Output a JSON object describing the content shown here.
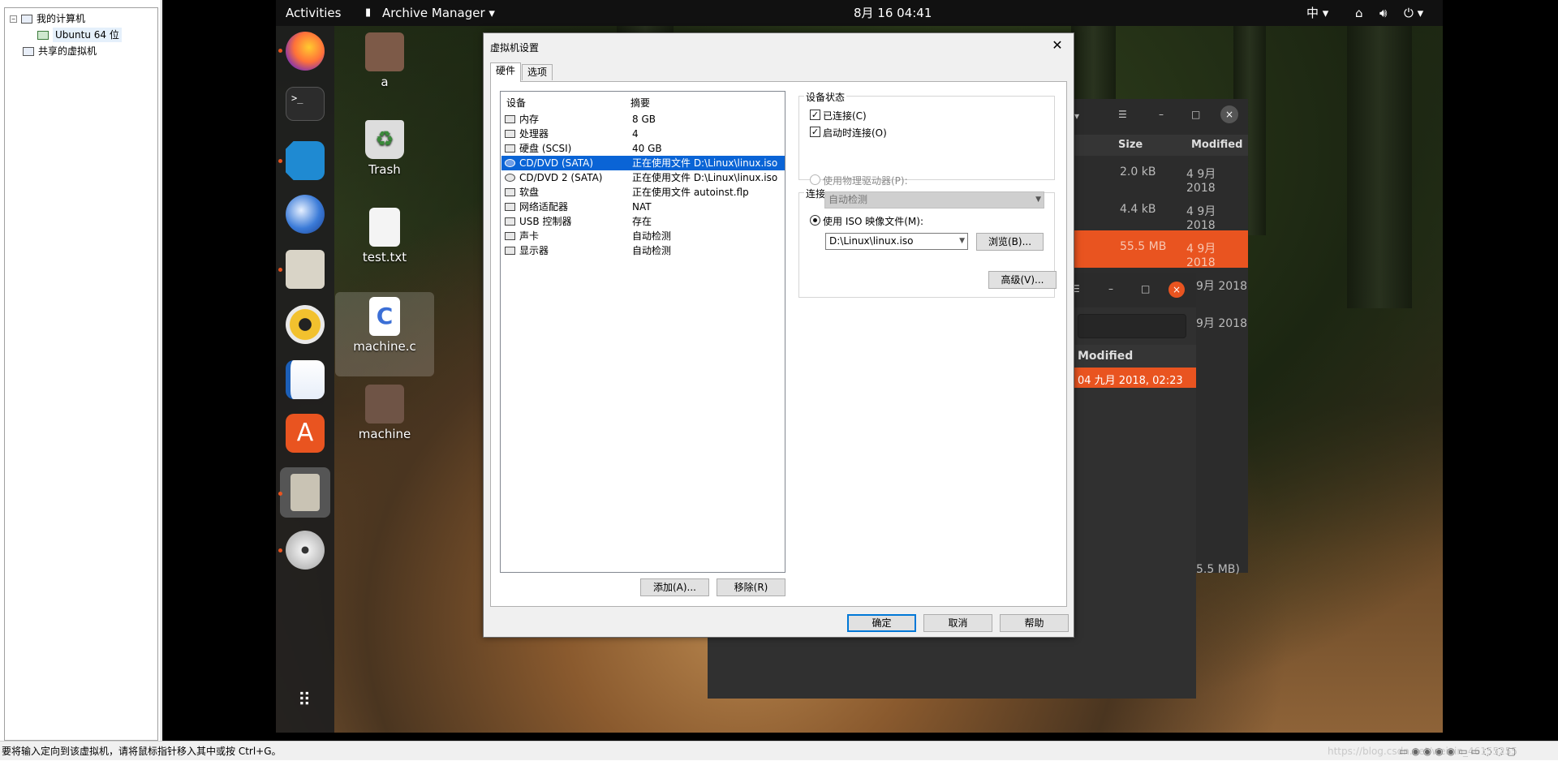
{
  "library": {
    "tree": [
      {
        "label": "我的计算机",
        "expander": "−"
      },
      {
        "label": "Ubuntu 64 位"
      },
      {
        "label": "共享的虚拟机",
        "expander": ""
      }
    ]
  },
  "ubuntu": {
    "activities": "Activities",
    "app_menu": "Archive Manager",
    "clock": "8月 16  04:41",
    "input_method": "中",
    "desktop_icons": [
      "a",
      "Trash",
      "test.txt",
      "machine.c",
      "machine"
    ],
    "dock_apps": [
      "firefox-icon",
      "terminal-icon",
      "vscode-icon",
      "thunderbird-icon",
      "files-icon",
      "rhythmbox-icon",
      "writer-icon",
      "software-icon",
      "archive-icon",
      "dvd-icon",
      "app-grid-icon"
    ]
  },
  "archive_window_back": {
    "columns": [
      "Size",
      "Modified"
    ],
    "rows": [
      {
        "size": "2.0 kB",
        "modified": "4 9月 2018"
      },
      {
        "size": "4.4 kB",
        "modified": "4 9月 2018"
      },
      {
        "size": "55.5 MB",
        "modified": "4 9月 2018"
      },
      {
        "size": "",
        "modified": "9月 2018"
      },
      {
        "size": "",
        "modified": "9月 2018"
      }
    ],
    "footer": "5.5 MB)"
  },
  "archive_window_front": {
    "modified_header": "Modified",
    "selected_modified": "04 九月 2018, 02:23"
  },
  "dialog": {
    "title": "虚拟机设置",
    "tabs": [
      "硬件",
      "选项"
    ],
    "list_headers": {
      "device": "设备",
      "summary": "摘要"
    },
    "devices": [
      {
        "name": "内存",
        "summary": "8 GB"
      },
      {
        "name": "处理器",
        "summary": "4"
      },
      {
        "name": "硬盘 (SCSI)",
        "summary": "40 GB"
      },
      {
        "name": "CD/DVD (SATA)",
        "summary": "正在使用文件 D:\\Linux\\linux.iso"
      },
      {
        "name": "CD/DVD 2 (SATA)",
        "summary": "正在使用文件 D:\\Linux\\linux.iso"
      },
      {
        "name": "软盘",
        "summary": "正在使用文件 autoinst.flp"
      },
      {
        "name": "网络适配器",
        "summary": "NAT"
      },
      {
        "name": "USB 控制器",
        "summary": "存在"
      },
      {
        "name": "声卡",
        "summary": "自动检测"
      },
      {
        "name": "显示器",
        "summary": "自动检测"
      }
    ],
    "add_button": "添加(A)...",
    "remove_button": "移除(R)",
    "device_status": {
      "label": "设备状态",
      "connected": "已连接(C)",
      "connect_on_start": "启动时连接(O)"
    },
    "connection": {
      "label": "连接",
      "physical_drive": "使用物理驱动器(P):",
      "auto_detect": "自动检测",
      "use_iso": "使用 ISO 映像文件(M):",
      "iso_path": "D:\\Linux\\linux.iso",
      "browse": "浏览(B)..."
    },
    "advanced": "高级(V)...",
    "ok": "确定",
    "cancel": "取消",
    "help": "帮助"
  },
  "statusbar": {
    "message": "要将输入定向到该虚拟机，请将鼠标指针移入其中或按 Ctrl+G。",
    "watermark": "https://blog.csdn.net/weixin_46155255"
  },
  "colors": {
    "ubuntu_orange": "#e95420",
    "selection_blue": "#0a64d6"
  }
}
